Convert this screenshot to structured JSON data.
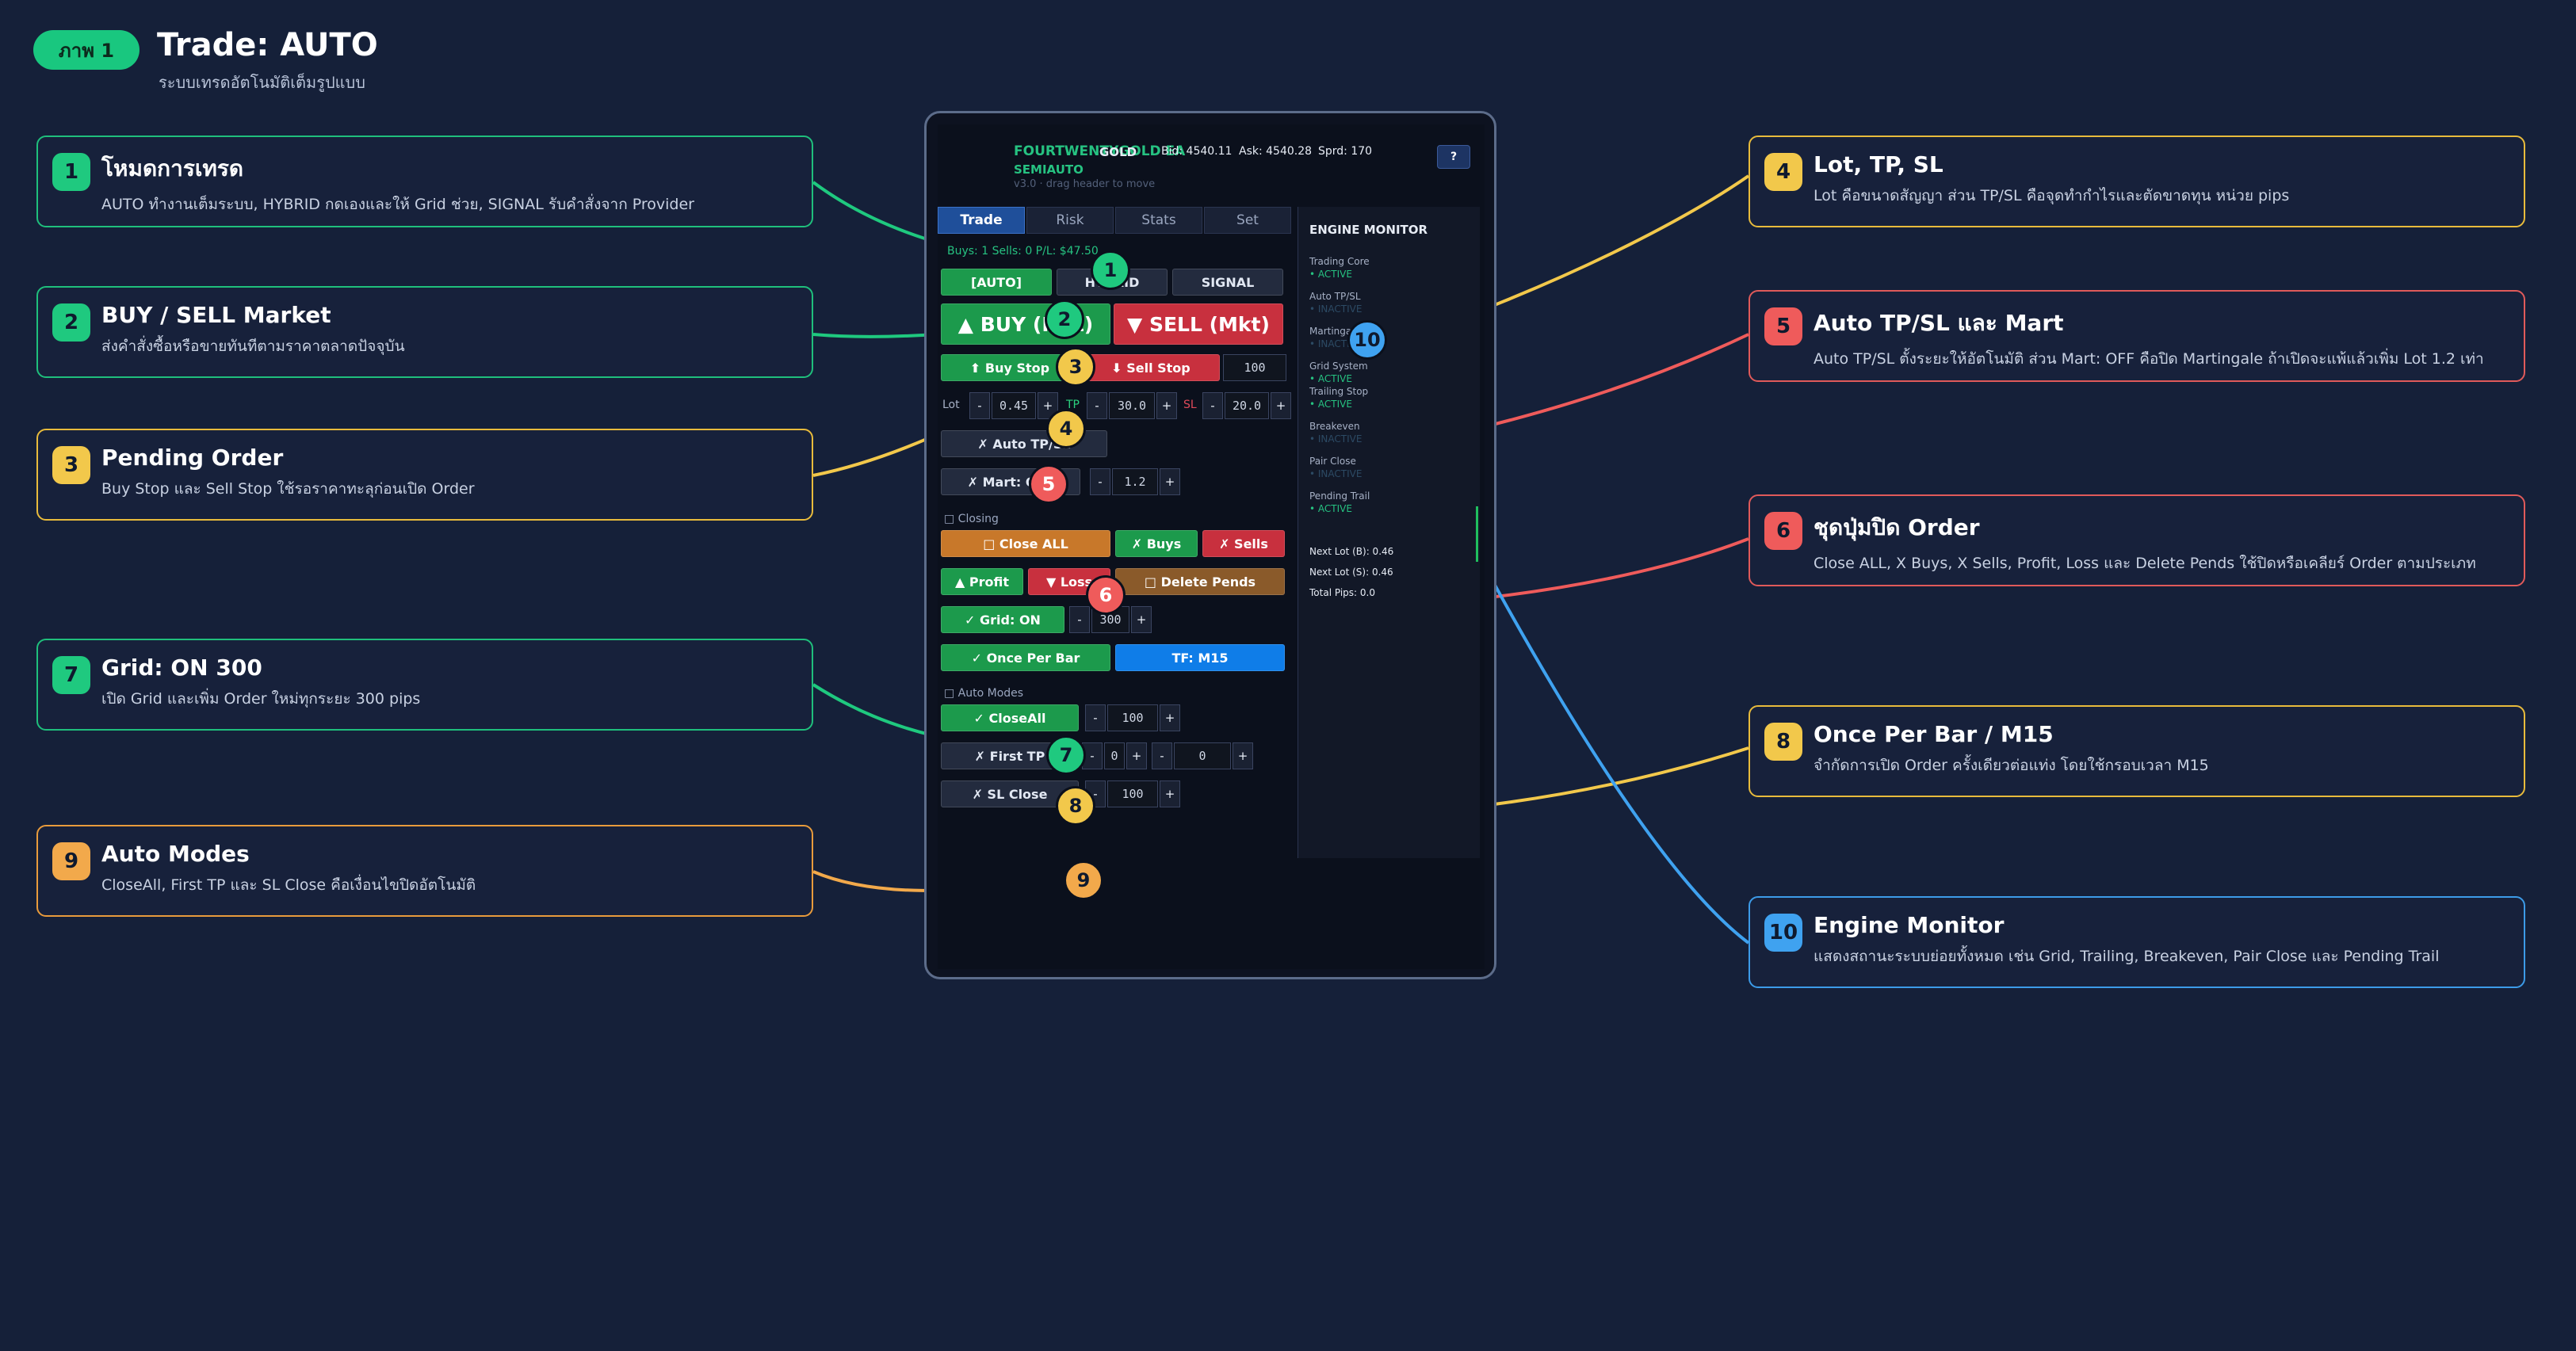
{
  "header": {
    "badge": "ภาพ 1",
    "title": "Trade: AUTO",
    "subtitle": "ระบบเทรดอัตโนมัติเต็มรูปแบบ"
  },
  "callouts": [
    {
      "num": "1",
      "title": "โหมดการเทรด",
      "desc": "AUTO ทำงานเต็มระบบ, HYBRID กดเองและให้ Grid ช่วย, SIGNAL รับคำสั่งจาก Provider",
      "color": "#1fc97f"
    },
    {
      "num": "2",
      "title": "BUY / SELL Market",
      "desc": "ส่งคำสั่งซื้อหรือขายทันทีตามราคาตลาดปัจจุบัน",
      "color": "#1fc97f"
    },
    {
      "num": "3",
      "title": "Pending Order",
      "desc": "Buy Stop และ Sell Stop ใช้รอราคาทะลุก่อนเปิด Order",
      "color": "#f2c84b"
    },
    {
      "num": "4",
      "title": "Lot, TP, SL",
      "desc": "Lot คือขนาดสัญญา ส่วน TP/SL คือจุดทำกำไรและตัดขาดทุน หน่วย pips",
      "color": "#f2c84b"
    },
    {
      "num": "5",
      "title": "Auto TP/SL และ Mart",
      "desc": "Auto TP/SL ตั้งระยะให้อัตโนมัติ ส่วน Mart: OFF คือปิด Martingale ถ้าเปิดจะแพ้แล้วเพิ่ม Lot 1.2 เท่า",
      "color": "#ef5b5b"
    },
    {
      "num": "6",
      "title": "ชุดปุ่มปิด Order",
      "desc": "Close ALL, X Buys, X Sells, Profit, Loss และ Delete Pends ใช้ปิดหรือเคลียร์ Order ตามประเภท",
      "color": "#ef5b5b"
    },
    {
      "num": "7",
      "title": "Grid: ON 300",
      "desc": "เปิด Grid และเพิ่ม Order ใหม่ทุกระยะ 300 pips",
      "color": "#1fc97f"
    },
    {
      "num": "8",
      "title": "Once Per Bar / M15",
      "desc": "จำกัดการเปิด Order ครั้งเดียวต่อแท่ง โดยใช้กรอบเวลา M15",
      "color": "#f2c84b"
    },
    {
      "num": "9",
      "title": "Auto Modes",
      "desc": "CloseAll, First TP และ SL Close คือเงื่อนไขปิดอัตโนมัติ",
      "color": "#f2a94b"
    },
    {
      "num": "10",
      "title": "Engine Monitor",
      "desc": "แสดงสถานะระบบย่อยทั้งหมด เช่น Grid, Trailing, Breakeven, Pair Close และ Pending Trail",
      "color": "#3fa2f0"
    }
  ],
  "panel": {
    "name": "FOURTWENTYGOLD EA",
    "symbol": "GOLD",
    "bid": "Bid: 4540.11",
    "ask": "Ask: 4540.28",
    "spread": "Sprd: 170",
    "mode": "SEMIAUTO",
    "version": "v3.0 · drag header to move",
    "help": "?",
    "tabs": [
      "Trade",
      "Risk",
      "Stats",
      "Set"
    ],
    "stats_line": "Buys: 1   Sells: 0   P/L: $47.50",
    "mode_buttons": [
      "[AUTO]",
      "HYBRID",
      "SIGNAL"
    ],
    "buy_label": "▲ BUY (Mkt)",
    "sell_label": "▼ SELL (Mkt)",
    "buy_stop": "⬆ Buy Stop",
    "sell_stop": "⬇ Sell Stop",
    "pending_dist": "100",
    "lot_label": "Lot",
    "lot_value": "0.45",
    "tp_label": "TP",
    "tp_value": "30.0",
    "sl_label": "SL",
    "sl_value": "20.0",
    "auto_tpsl": "✗ Auto TP/SL",
    "mart": "✗ Mart: OFF",
    "mart_value": "1.2",
    "closing_section": "□ Closing",
    "close_all": "□ Close ALL",
    "x_buys": "✗ Buys",
    "x_sells": "✗ Sells",
    "profit": "▲ Profit",
    "loss": "▼ Loss",
    "delete_pends": "□ Delete Pends",
    "grid": "✓ Grid: ON",
    "grid_value": "300",
    "once_per_bar": "✓ Once Per Bar",
    "tf": "TF: M15",
    "auto_section": "□ Auto Modes",
    "close_all_mode": "✓ CloseAll",
    "close_all_value": "100",
    "first_tp": "✗ First TP",
    "first_tp_value": "0",
    "first_tp_value2": "0",
    "sl_close": "✗ SL Close",
    "sl_close_value": "100",
    "minus": "-",
    "plus": "+"
  },
  "engine": {
    "title": "ENGINE MONITOR",
    "items": [
      {
        "name": "Trading Core",
        "status": "• ACTIVE",
        "dim": false
      },
      {
        "name": "Auto TP/SL",
        "status": "• INACTIVE",
        "dim": true
      },
      {
        "name": "Martingale",
        "status": "• INACTIVE",
        "dim": true
      },
      {
        "name": "Grid System",
        "status": "• ACTIVE",
        "dim": false
      },
      {
        "name": "Trailing Stop",
        "status": "• ACTIVE",
        "dim": false
      },
      {
        "name": "Breakeven",
        "status": "• INACTIVE",
        "dim": true
      },
      {
        "name": "Pair Close",
        "status": "• INACTIVE",
        "dim": true
      },
      {
        "name": "Pending Trail",
        "status": "• ACTIVE",
        "dim": false
      }
    ],
    "next_lot_b": "Next Lot (B): 0.46",
    "next_lot_s": "Next Lot (S): 0.46",
    "total_pips": "Total Pips: 0.0"
  }
}
